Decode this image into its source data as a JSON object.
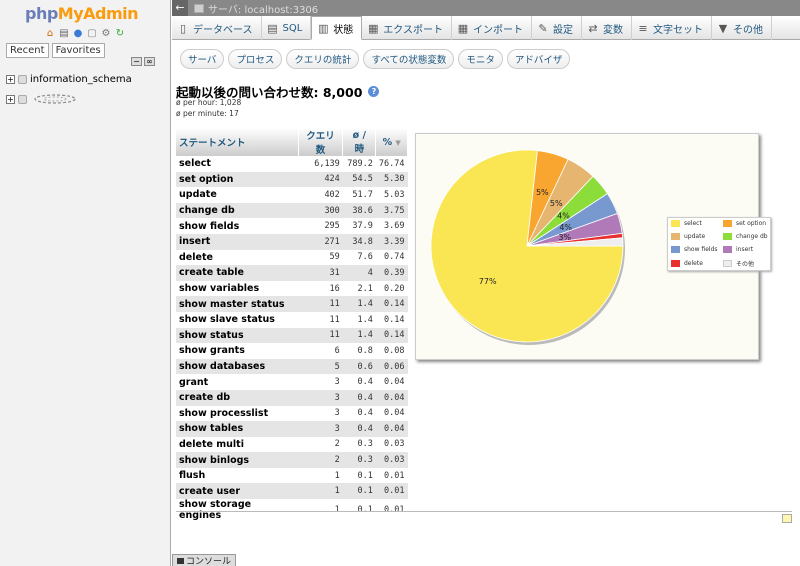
{
  "nav": {
    "logo_php": "php",
    "logo_my": "My",
    "logo_admin": "Admin",
    "tab_recent": "Recent",
    "tab_favorites": "Favorites",
    "databases": [
      "information_schema"
    ]
  },
  "serverbar": {
    "title": "サーバ: localhost:3306"
  },
  "menu": {
    "tabs": [
      {
        "label": "データベース",
        "icon": "database-icon"
      },
      {
        "label": "SQL",
        "icon": "sql-icon"
      },
      {
        "label": "状態",
        "icon": "status-icon",
        "active": true
      },
      {
        "label": "エクスポート",
        "icon": "export-icon"
      },
      {
        "label": "インポート",
        "icon": "import-icon"
      },
      {
        "label": "設定",
        "icon": "wrench-icon"
      },
      {
        "label": "変数",
        "icon": "variables-icon"
      },
      {
        "label": "文字セット",
        "icon": "charset-icon"
      },
      {
        "label": "その他",
        "icon": "chevron-down-icon"
      }
    ]
  },
  "submenu": [
    "サーバ",
    "プロセス",
    "クエリの統計",
    "すべての状態変数",
    "モニタ",
    "アドバイザ"
  ],
  "heading": {
    "title": "起動以後の問い合わせ数: 8,000",
    "per_hour": "ø per hour: 1,028",
    "per_minute": "ø per minute: 17"
  },
  "table": {
    "headers": [
      "ステートメント",
      "クエリ数",
      "ø / 時",
      "%"
    ],
    "rows": [
      [
        "select",
        "6,139",
        "789.2",
        "76.74"
      ],
      [
        "set option",
        "424",
        "54.5",
        "5.30"
      ],
      [
        "update",
        "402",
        "51.7",
        "5.03"
      ],
      [
        "change db",
        "300",
        "38.6",
        "3.75"
      ],
      [
        "show fields",
        "295",
        "37.9",
        "3.69"
      ],
      [
        "insert",
        "271",
        "34.8",
        "3.39"
      ],
      [
        "delete",
        "59",
        "7.6",
        "0.74"
      ],
      [
        "create table",
        "31",
        "4",
        "0.39"
      ],
      [
        "show variables",
        "16",
        "2.1",
        "0.20"
      ],
      [
        "show master status",
        "11",
        "1.4",
        "0.14"
      ],
      [
        "show slave status",
        "11",
        "1.4",
        "0.14"
      ],
      [
        "show status",
        "11",
        "1.4",
        "0.14"
      ],
      [
        "show grants",
        "6",
        "0.8",
        "0.08"
      ],
      [
        "show databases",
        "5",
        "0.6",
        "0.06"
      ],
      [
        "grant",
        "3",
        "0.4",
        "0.04"
      ],
      [
        "create db",
        "3",
        "0.4",
        "0.04"
      ],
      [
        "show processlist",
        "3",
        "0.4",
        "0.04"
      ],
      [
        "show tables",
        "3",
        "0.4",
        "0.04"
      ],
      [
        "delete multi",
        "2",
        "0.3",
        "0.03"
      ],
      [
        "show binlogs",
        "2",
        "0.3",
        "0.03"
      ],
      [
        "flush",
        "1",
        "0.1",
        "0.01"
      ],
      [
        "create user",
        "1",
        "0.1",
        "0.01"
      ],
      [
        "show storage engines",
        "1",
        "0.1",
        "0.01"
      ]
    ]
  },
  "chart_data": {
    "type": "pie",
    "categories": [
      "select",
      "set option",
      "update",
      "change db",
      "show fields",
      "insert",
      "delete",
      "その他"
    ],
    "values": [
      76.74,
      5.3,
      5.03,
      3.75,
      3.69,
      3.39,
      0.74,
      1.36
    ],
    "slice_labels": [
      "77%",
      "5%",
      "5%",
      "4%",
      "4%",
      "3%",
      "",
      ""
    ],
    "colors": [
      "#fae652",
      "#f8a630",
      "#e6b56f",
      "#8cdc3a",
      "#7898d0",
      "#b07ab8",
      "#e83030",
      "#eeeeee"
    ],
    "legend_position": "right"
  },
  "console": {
    "label": "コンソール"
  }
}
